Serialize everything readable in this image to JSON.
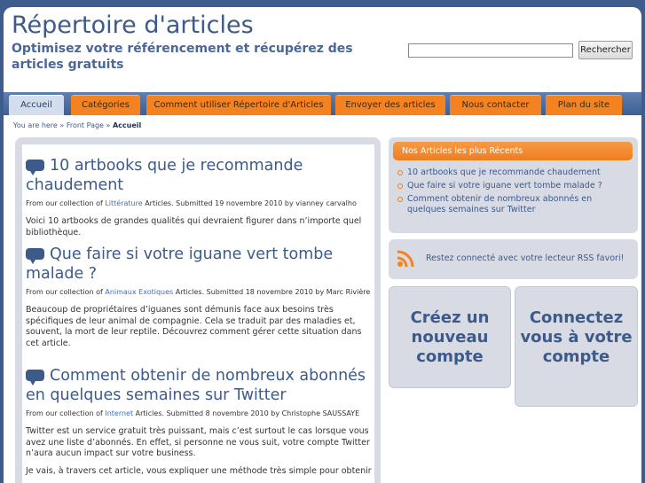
{
  "header": {
    "title": "Répertoire d'articles",
    "subtitle": "Optimisez votre référencement et récupérez des articles gratuits",
    "search_value": "",
    "search_button": "Rechercher"
  },
  "nav": [
    {
      "label": "Accueil",
      "active": true
    },
    {
      "label": "Catégories"
    },
    {
      "label": "Comment utiliser Répertoire d'Articles"
    },
    {
      "label": "Envoyer des articles"
    },
    {
      "label": "Nous contacter"
    },
    {
      "label": "Plan du site"
    }
  ],
  "breadcrumb": {
    "prefix": "You are here »",
    "front": "Front Page",
    "sep": "»",
    "current": "Accueil"
  },
  "articles": [
    {
      "title": "10 artbooks que je recommande chaudement",
      "meta_prefix": "From our collection of",
      "category": "Littérature",
      "meta_suffix": "Articles. Submitted 19 novembre 2010 by vianney carvalho",
      "excerpt": "Voici 10 artbooks de grandes qualités qui devraient figurer dans n’importe quel bibliothèque."
    },
    {
      "title": "Que faire si votre iguane vert tombe malade ?",
      "meta_prefix": "From our collection of",
      "category": "Animaux Exotiques",
      "meta_suffix": "Articles. Submitted 18 novembre 2010 by Marc Rivière",
      "excerpt": "Beaucoup de propriétaires d’iguanes sont démunis face aux besoins très spécifiques de leur animal de compagnie. Cela se traduit par des maladies et, souvent, la mort de leur reptile. Découvrez comment gérer cette situation dans cet article."
    },
    {
      "title": "Comment obtenir de nombreux abonnés en quelques semaines sur Twitter",
      "meta_prefix": "From our collection of",
      "category": "Internet",
      "meta_suffix": "Articles. Submitted 8 novembre 2010 by Christophe SAUSSAYE",
      "excerpt": "Twitter est un service gratuit très puissant, mais c’est surtout le cas lorsque vous avez une liste d’abonnés. En effet, si personne ne vous suit, votre compte Twitter n’aura aucun impact sur votre business.",
      "excerpt2": "Je vais, à travers cet article, vous expliquer une méthode très simple pour obtenir"
    }
  ],
  "sidebar": {
    "recent_title": "Nos Articles les plus Récents",
    "recent_items": [
      "10 artbooks que je recommande chaudement",
      "Que faire si votre iguane vert tombe malade ?",
      "Comment obtenir de nombreux abonnés en quelques semaines sur Twitter"
    ],
    "rss_text": "Restez connecté avec votre lecteur RSS favori!",
    "create_account": "Créez un nouveau compte",
    "login": "Connectez vous à votre compte"
  },
  "colors": {
    "accent": "#f58220",
    "brand": "#3c5a8a",
    "background": "#3f5d8c"
  }
}
